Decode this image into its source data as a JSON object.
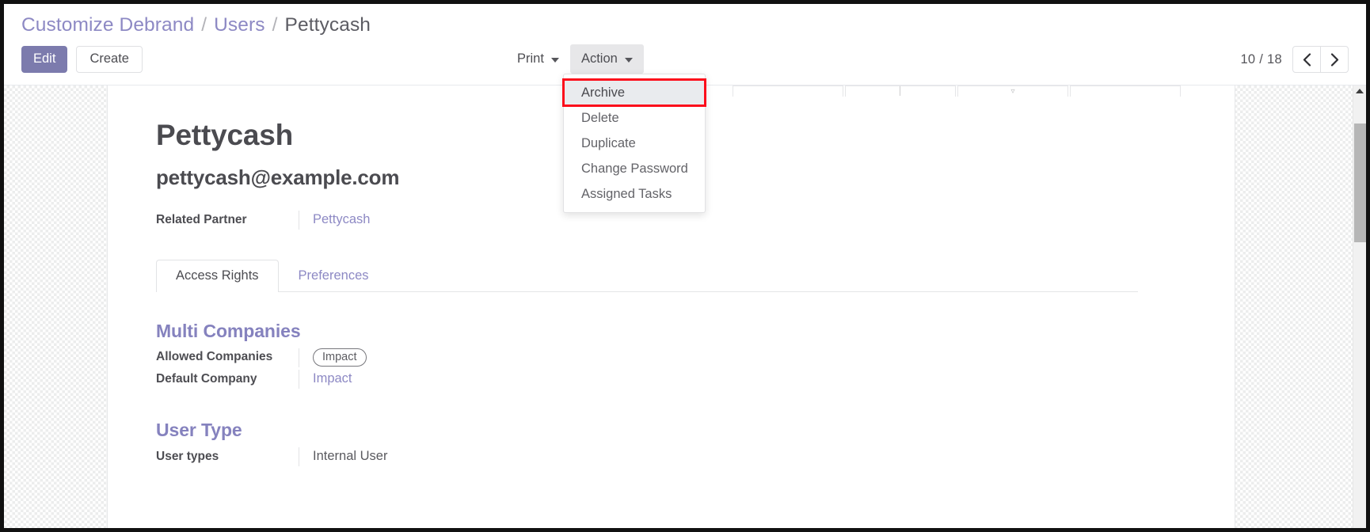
{
  "breadcrumb": {
    "items": [
      {
        "label": "Customize Debrand",
        "type": "link"
      },
      {
        "label": "Users",
        "type": "link"
      },
      {
        "label": "Pettycash",
        "type": "current"
      }
    ],
    "separator": "/"
  },
  "toolbar": {
    "edit_label": "Edit",
    "create_label": "Create",
    "print_label": "Print",
    "action_label": "Action"
  },
  "action_menu": {
    "items": [
      {
        "label": "Archive",
        "highlighted": true
      },
      {
        "label": "Delete",
        "highlighted": false
      },
      {
        "label": "Duplicate",
        "highlighted": false
      },
      {
        "label": "Change Password",
        "highlighted": false
      },
      {
        "label": "Assigned Tasks",
        "highlighted": false
      }
    ]
  },
  "pager": {
    "count": "10 / 18",
    "prev_icon": "chevron-left-icon",
    "next_icon": "chevron-right-icon",
    "prev_glyph": "‹",
    "next_glyph": "›"
  },
  "record": {
    "title": "Pettycash",
    "email": "pettycash@example.com",
    "related_partner_label": "Related Partner",
    "related_partner_value": "Pettycash"
  },
  "tabs": [
    {
      "label": "Access Rights",
      "active": true
    },
    {
      "label": "Preferences",
      "active": false
    }
  ],
  "groups": [
    {
      "title": "Multi Companies",
      "fields": [
        {
          "label": "Allowed Companies",
          "value": "Impact",
          "style": "badge"
        },
        {
          "label": "Default Company",
          "value": "Impact",
          "style": "link"
        }
      ]
    },
    {
      "title": "User Type",
      "fields": [
        {
          "label": "User types",
          "value": "Internal User",
          "style": "text"
        }
      ]
    }
  ],
  "colors": {
    "brand_purple": "#7c7bad",
    "link_purple": "#8d89c4",
    "group_title": "#8582be",
    "highlight_red": "#fc0d1b",
    "text_dark": "#4d4d52"
  },
  "scrollbar": {
    "up_icon": "scroll-up-arrow-icon"
  }
}
